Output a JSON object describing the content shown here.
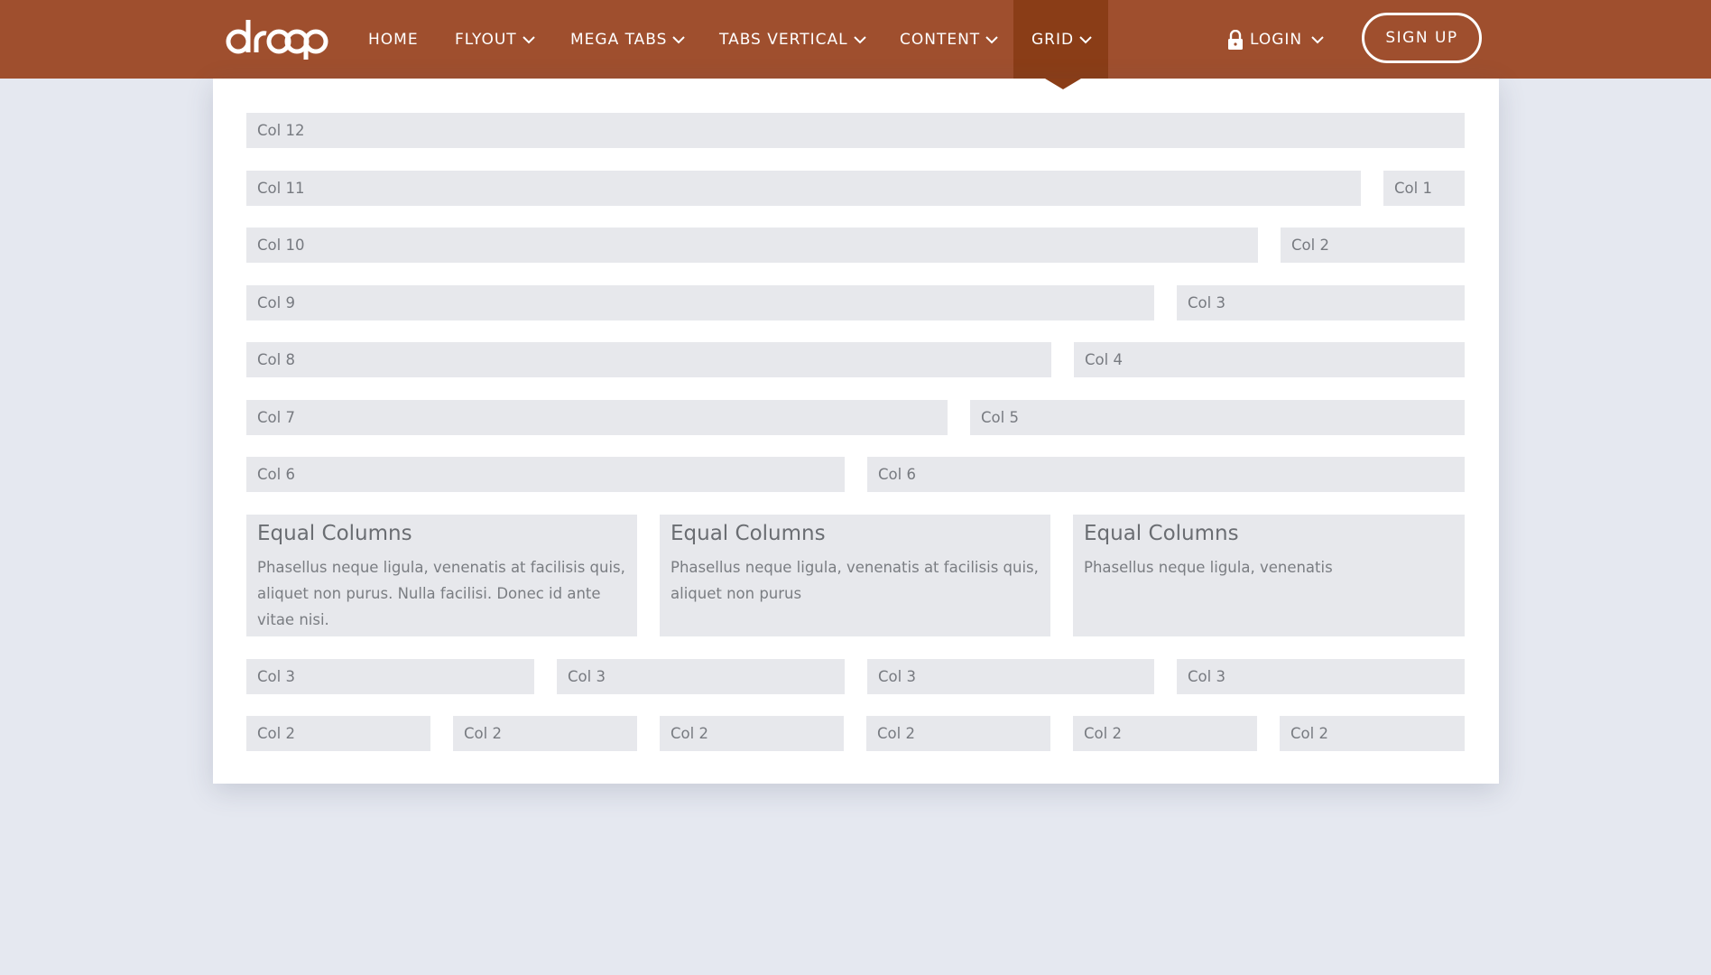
{
  "brand": {
    "logo_text": "droop",
    "accent_color": "#9f4f2e",
    "active_color": "#8a3d17"
  },
  "nav": {
    "home": "HOME",
    "flyout": "FLYOUT",
    "mega_tabs": "MEGA TABS",
    "tabs_vertical": "TABS VERTICAL",
    "content": "CONTENT",
    "grid": "GRID",
    "login": "LOGIN",
    "signup": "SIGN UP",
    "active_item": "GRID"
  },
  "grid": {
    "row12": [
      "Col 12"
    ],
    "row11": [
      "Col 11",
      "Col 1"
    ],
    "row10": [
      "Col 10",
      "Col 2"
    ],
    "row9": [
      "Col 9",
      "Col 3"
    ],
    "row8": [
      "Col 8",
      "Col 4"
    ],
    "row7": [
      "Col 7",
      "Col 5"
    ],
    "row6": [
      "Col 6",
      "Col 6"
    ],
    "equal": [
      {
        "title": "Equal Columns",
        "text": "Phasellus neque ligula, venenatis at facilisis quis, aliquet non purus. Nulla facilisi. Donec id ante vitae nisi."
      },
      {
        "title": "Equal Columns",
        "text": "Phasellus neque ligula, venenatis at facilisis quis, aliquet non purus"
      },
      {
        "title": "Equal Columns",
        "text": "Phasellus neque ligula, venenatis"
      }
    ],
    "row3": [
      "Col 3",
      "Col 3",
      "Col 3",
      "Col 3"
    ],
    "row2": [
      "Col 2",
      "Col 2",
      "Col 2",
      "Col 2",
      "Col 2",
      "Col 2"
    ]
  }
}
